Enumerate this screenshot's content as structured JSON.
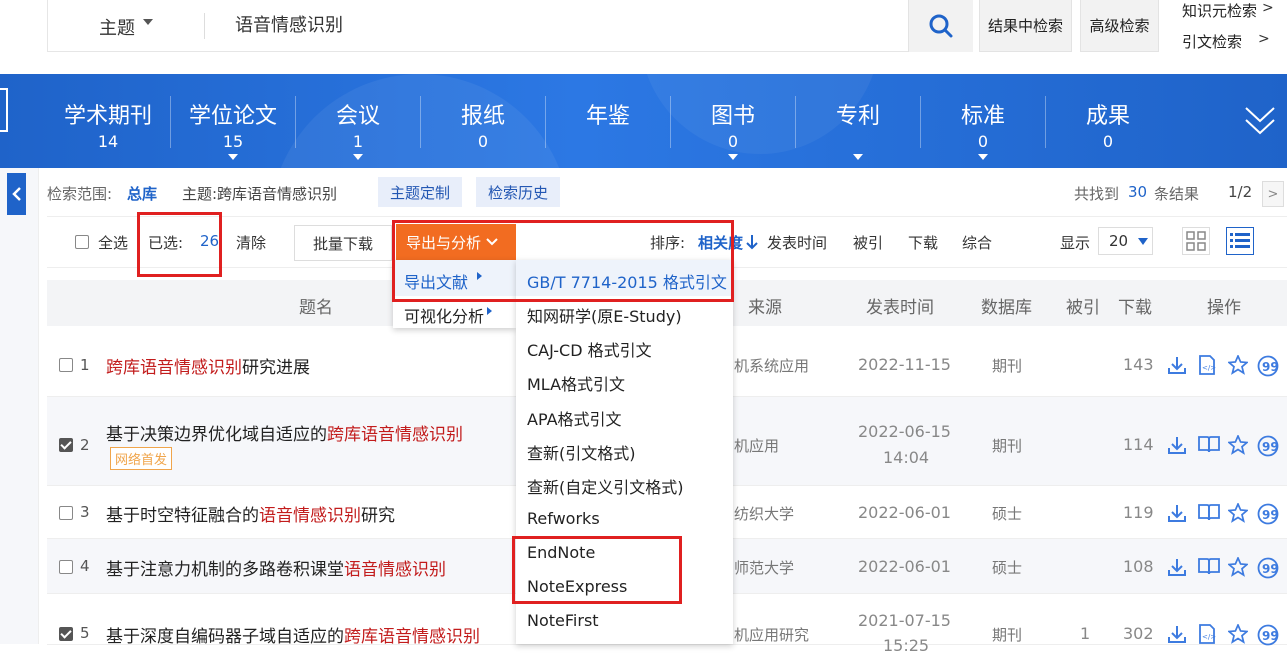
{
  "search": {
    "field": "主题",
    "query": "语音情感识别",
    "within_label": "结果中检索",
    "advanced_label": "高级检索",
    "right_links": [
      "知识元检索",
      "引文检索"
    ]
  },
  "categories": [
    {
      "label": "学术期刊",
      "count": "14"
    },
    {
      "label": "学位论文",
      "count": "15"
    },
    {
      "label": "会议",
      "count": "1"
    },
    {
      "label": "报纸",
      "count": "0"
    },
    {
      "label": "年鉴",
      "count": ""
    },
    {
      "label": "图书",
      "count": "0"
    },
    {
      "label": "专利",
      "count": ""
    },
    {
      "label": "标准",
      "count": "0"
    },
    {
      "label": "成果",
      "count": "0"
    }
  ],
  "scope": {
    "label": "检索范围:",
    "value": "总库",
    "topic": "主题:跨库语音情感识别",
    "custom_btn": "主题定制",
    "history_btn": "检索历史",
    "found_prefix": "共找到",
    "found_count": "30",
    "found_suffix": "条结果",
    "page": "1/2"
  },
  "toolbar": {
    "select_all": "全选",
    "selected_label": "已选:",
    "selected_count": "26",
    "clear": "清除",
    "batch_download": "批量下载",
    "export": "导出与分析",
    "sort_label": "排序:",
    "sort_options": [
      "相关度",
      "发表时间",
      "被引",
      "下载",
      "综合"
    ],
    "display_label": "显示",
    "per_page": "20"
  },
  "table_header": {
    "title": "题名",
    "source": "来源",
    "date": "发表时间",
    "db": "数据库",
    "cited": "被引",
    "downloads": "下载",
    "ops": "操作"
  },
  "rows": [
    {
      "num": "1",
      "checked": false,
      "t_pre": "",
      "t_hl": "跨库语音情感识别",
      "t_post": "研究进展",
      "source": "机系统应用",
      "date": "2022-11-15",
      "time": "",
      "db": "期刊",
      "cited": "",
      "downloads": "143"
    },
    {
      "num": "2",
      "checked": true,
      "t_pre": "基于决策边界优化域自适应的",
      "t_hl": "跨库语音情感识别",
      "t_post": "",
      "badge": "网络首发",
      "source": "机应用",
      "date": "2022-06-15",
      "time": "14:04",
      "db": "期刊",
      "cited": "",
      "downloads": "114"
    },
    {
      "num": "3",
      "checked": false,
      "t_pre": "基于时空特征融合的",
      "t_hl": "语音情感识别",
      "t_post": "研究",
      "source": "纺织大学",
      "date": "2022-06-01",
      "time": "",
      "db": "硕士",
      "cited": "",
      "downloads": "119"
    },
    {
      "num": "4",
      "checked": false,
      "t_pre": "基于注意力机制的多路卷积课堂",
      "t_hl": "语音情感识别",
      "t_post": "",
      "source": "师范大学",
      "date": "2022-06-01",
      "time": "",
      "db": "硕士",
      "cited": "",
      "downloads": "108"
    },
    {
      "num": "5",
      "checked": true,
      "t_pre": "基于深度自编码器子域自适应的",
      "t_hl": "跨库语音情感识别",
      "t_post": "",
      "source": "机应用研究",
      "date": "2021-07-15",
      "time": "15:25",
      "db": "期刊",
      "cited": "1",
      "downloads": "302"
    }
  ],
  "export_menu": {
    "items": [
      "导出文献",
      "可视化分析"
    ],
    "formats": [
      "GB/T 7714-2015 格式引文",
      "知网研学(原E-Study)",
      "CAJ-CD 格式引文",
      "MLA格式引文",
      "APA格式引文",
      "查新(引文格式)",
      "查新(自定义引文格式)",
      "Refworks",
      "EndNote",
      "NoteExpress",
      "NoteFirst"
    ]
  },
  "colors": {
    "brand_blue": "#1f63c9",
    "export_orange": "#f26c21",
    "highlight_red": "#c21c1c",
    "annotation_red": "#e02020"
  }
}
